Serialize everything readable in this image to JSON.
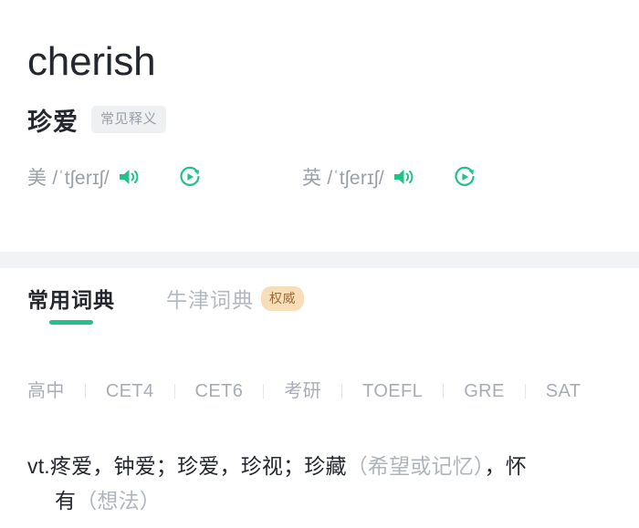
{
  "entry": {
    "word": "cherish",
    "meaning_cn": "珍爱",
    "common_badge": "常见释义"
  },
  "phonetics": {
    "us": {
      "locale_label": "美",
      "ipa": "/ˈtʃerɪʃ/",
      "speaker_icon": "speaker-icon",
      "replay_icon": "replay-circle-icon"
    },
    "uk": {
      "locale_label": "英",
      "ipa": "/ˈtʃerɪʃ/",
      "speaker_icon": "speaker-icon",
      "replay_icon": "replay-circle-icon"
    }
  },
  "tabs": [
    {
      "label": "常用词典",
      "active": true,
      "badge": ""
    },
    {
      "label": "牛津词典",
      "active": false,
      "badge": "权威"
    }
  ],
  "exam_tags": [
    "高中",
    "CET4",
    "CET6",
    "考研",
    "TOEFL",
    "GRE",
    "SAT"
  ],
  "definition": {
    "line1_pos": "vt.",
    "line1_main_a": "疼爱，钟爱；珍爱，珍视；珍藏",
    "line1_paren": "（希望或记忆）",
    "line1_main_b": "，怀",
    "line2_main": "有",
    "line2_paren": "（想法）"
  },
  "colors": {
    "accent_green": "#22c187",
    "badge_gray_bg": "#eef0f2",
    "badge_gray_text": "#9aa0a8",
    "badge_auth_bg": "#f7ddb8",
    "badge_auth_text": "#9c6b3e",
    "band_gray": "#f2f3f5",
    "text_primary": "#24272e",
    "text_muted": "#a8adb5"
  }
}
